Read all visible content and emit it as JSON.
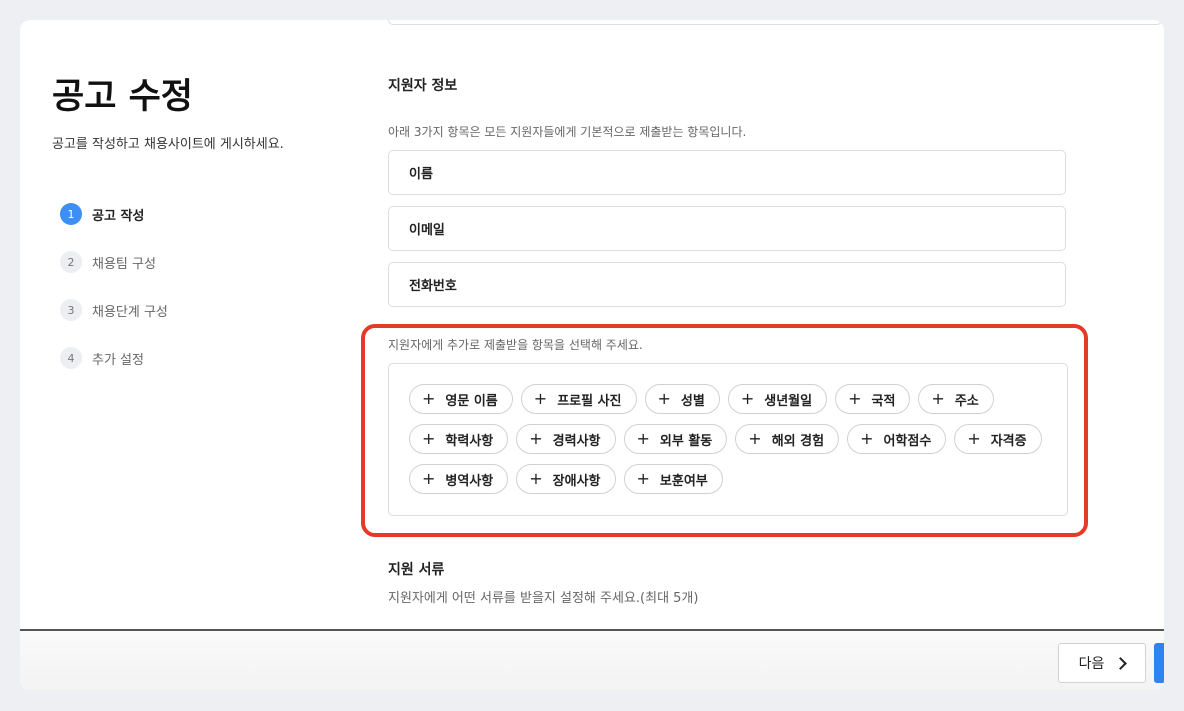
{
  "page": {
    "title": "공고 수정",
    "subtitle": "공고를 작성하고 채용사이트에 게시하세요."
  },
  "steps": [
    {
      "num": "1",
      "label": "공고 작성",
      "active": true
    },
    {
      "num": "2",
      "label": "채용팀 구성",
      "active": false
    },
    {
      "num": "3",
      "label": "채용단계 구성",
      "active": false
    },
    {
      "num": "4",
      "label": "추가 설정",
      "active": false
    }
  ],
  "applicant_info": {
    "title": "지원자 정보",
    "basic_desc": "아래 3가지 항목은 모든 지원자들에게 기본적으로 제출받는 항목입니다.",
    "basic_fields": [
      "이름",
      "이메일",
      "전화번호"
    ],
    "extra_desc": "지원자에게 추가로 제출받을 항목을 선택해 주세요.",
    "extra_options": [
      "영문 이름",
      "프로필 사진",
      "성별",
      "생년월일",
      "국적",
      "주소",
      "학력사항",
      "경력사항",
      "외부 활동",
      "해외 경험",
      "어학점수",
      "자격증",
      "병역사항",
      "장애사항",
      "보훈여부"
    ]
  },
  "documents": {
    "title": "지원 서류",
    "desc": "지원자에게 어떤 서류를 받을지 설정해 주세요.(최대 5개)"
  },
  "footer": {
    "next_label": "다음"
  },
  "colors": {
    "accent": "#3d8ef5",
    "highlight": "#e53a28"
  }
}
